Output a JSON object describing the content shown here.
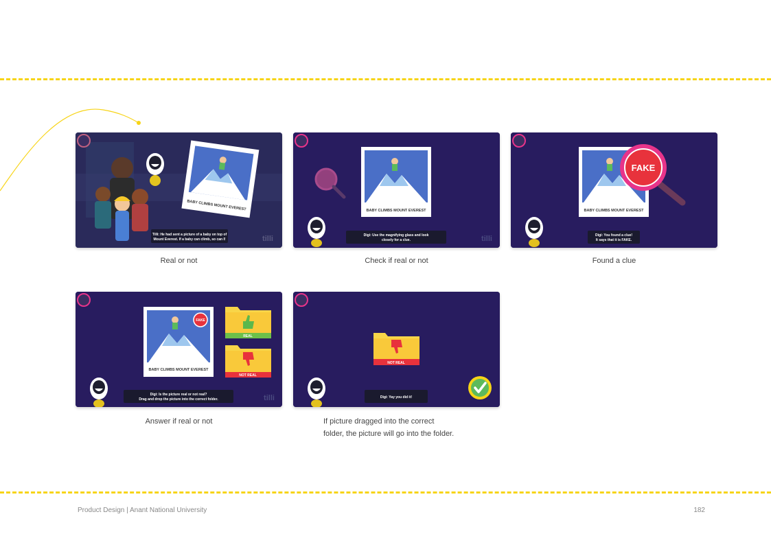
{
  "captions": {
    "c1": "Real or not",
    "c2": "Check if real or not",
    "c3": "Found a clue",
    "c4": "Answer if real or not",
    "c5_line1": "If picture dragged into the correct",
    "c5_line2": "folder, the picture will go into the folder."
  },
  "screens": {
    "photo_label": "BABY CLIMBS MOUNT EVEREST",
    "fake_badge": "FAKE",
    "real_folder": "REAL",
    "not_real_folder": "NOT REAL",
    "brand": "tilli",
    "s1_line1": "Tilli:  He had sent a picture of a baby on top of",
    "s1_line2": "Mount Everest. If a baby can climb, so can I!",
    "s2_line1": "Digi: Use the magnifying glass and look",
    "s2_line2": "closely for a clue.",
    "s3_line1": "Digi: You found a clue!",
    "s3_line2": "It says that it is FAKE.",
    "s4_line1": "Digi: Is the picture real or not real?",
    "s4_line2": "Drag and drop the picture into the correct folder.",
    "s5_line1": "Digi: Yay you did it!"
  },
  "footer": {
    "left": "Product Design | Anant National University",
    "page": "182"
  },
  "colors": {
    "background": "#281c5f",
    "accent_yellow": "#f7d417",
    "fake_red": "#e8323c",
    "magnifier_pink": "#e8348a",
    "folder_yellow": "#f8d548",
    "real_green": "#6cc04a"
  }
}
